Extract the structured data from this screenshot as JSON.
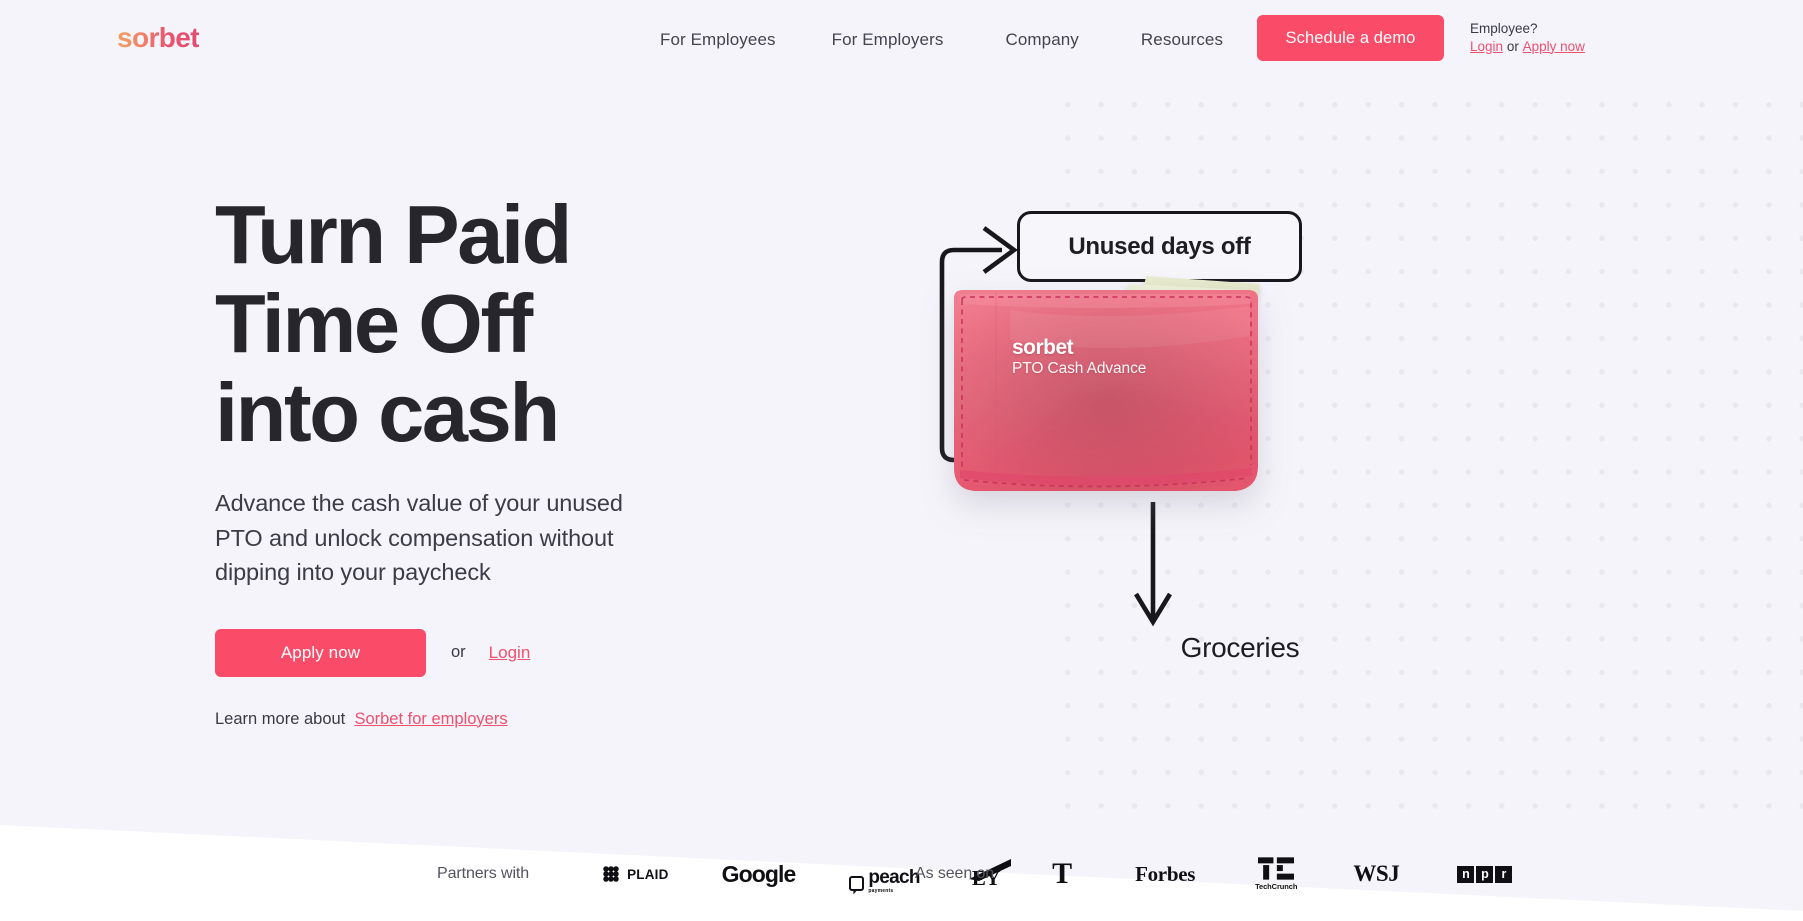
{
  "brand": {
    "logo_text": "sorbet",
    "logo_gradient_from": "#f0a15e",
    "logo_gradient_to": "#e14b73",
    "accent_pink": "#fa4b69",
    "link_pink": "#f0506e",
    "background": "#f5f4fa",
    "text_dark": "#26262c"
  },
  "header": {
    "nav": [
      {
        "label": "For Employees"
      },
      {
        "label": "For Employers"
      },
      {
        "label": "Company"
      },
      {
        "label": "Resources"
      }
    ],
    "demo_button": "Schedule a demo",
    "employee": {
      "label": "Employee?",
      "login": "Login",
      "or": "or",
      "apply": "Apply now"
    }
  },
  "hero": {
    "headline_lines": [
      "Turn Paid",
      "Time Off",
      "into cash"
    ],
    "subhead": "Advance the cash value of your unused PTO and unlock compensation without dipping into your paycheck",
    "apply_button": "Apply now",
    "or": "or",
    "login_link": "Login",
    "learn_prefix": "Learn more about",
    "learn_link": "Sorbet for employers "
  },
  "illustration": {
    "tag_label": "Unused days off",
    "wallet_brand": "sorbet",
    "wallet_sub": "PTO Cash Advance",
    "outcome_label": "Groceries",
    "wallet_color": "#ee6b80",
    "wallet_color_dark": "#e04a68",
    "bill_color": "#e6e9cc"
  },
  "logo_strip": {
    "partners_label": "Partners with",
    "partners": [
      {
        "name": "PLAID",
        "icon": "plaid-logo"
      },
      {
        "name": "Google",
        "icon": "google-logo"
      },
      {
        "name": "peach",
        "sub": "payments",
        "icon": "peach-logo"
      },
      {
        "name": "EY",
        "icon": "ey-logo"
      }
    ],
    "as_seen_label": "As seen on",
    "press": [
      {
        "name": "T",
        "icon": "new-york-times-logo"
      },
      {
        "name": "Forbes",
        "icon": "forbes-logo"
      },
      {
        "name": "TechCrunch",
        "icon": "techcrunch-logo"
      },
      {
        "name": "WSJ",
        "icon": "wsj-logo"
      },
      {
        "name": "npr",
        "letters": [
          "n",
          "p",
          "r"
        ],
        "icon": "npr-logo"
      }
    ]
  }
}
